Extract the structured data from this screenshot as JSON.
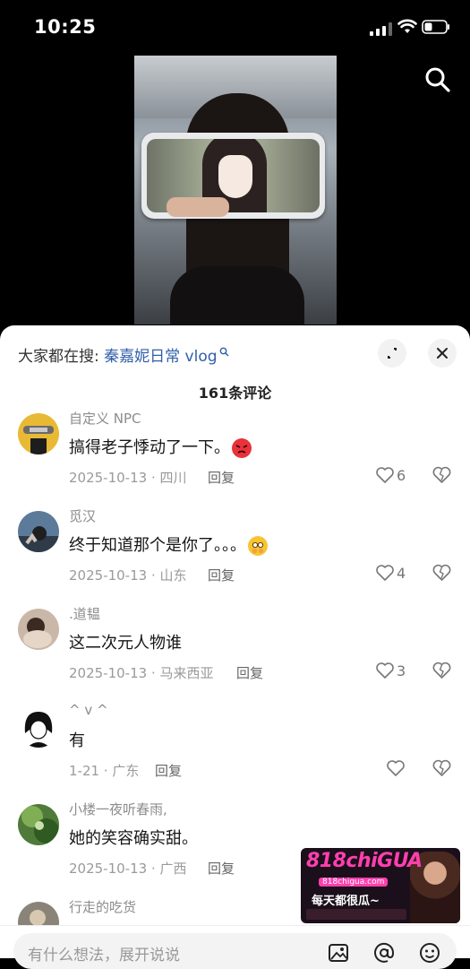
{
  "status_bar": {
    "time": "10:25"
  },
  "panel": {
    "search_hint": {
      "prefix": "大家都在搜:",
      "keyword": "秦嘉妮日常 vlog"
    },
    "comment_count": "161条评论"
  },
  "comments": [
    {
      "user": "自定义 NPC",
      "text": "搞得老子悸动了一下。",
      "emoji": "angry-face",
      "meta": "2025-10-13 · 四川",
      "reply": "回复",
      "likes": "6"
    },
    {
      "user": "觅汉",
      "text": "终于知道那个是你了。。。",
      "emoji": "pleading-face",
      "meta": "2025-10-13 · 山东",
      "reply": "回复",
      "likes": "4"
    },
    {
      "user": ".道韫",
      "text": "这二次元人物谁",
      "emoji": "",
      "meta": "2025-10-13 · 马来西亚",
      "reply": "回复",
      "likes": "3"
    },
    {
      "user": "^ v ^",
      "text": "有",
      "emoji": "",
      "meta": "1-21 · 广东",
      "reply": "回复",
      "likes": ""
    },
    {
      "user": "小楼一夜听春雨,",
      "text": "她的笑容确实甜。",
      "emoji": "",
      "meta": "2025-10-13 · 广西",
      "reply": "回复",
      "likes": ""
    },
    {
      "user": "行走的吃货",
      "text": "",
      "emoji": "",
      "meta": "",
      "reply": "",
      "likes": ""
    }
  ],
  "ad_banner": {
    "brand": "818chiGUA",
    "site": "818chigua.com",
    "slogan": "每天都很瓜~"
  },
  "input_bar": {
    "placeholder": "有什么想法，展开说说"
  },
  "colors": {
    "keyword_blue": "#2f5fa8",
    "ad_pink": "#ff3fae"
  }
}
